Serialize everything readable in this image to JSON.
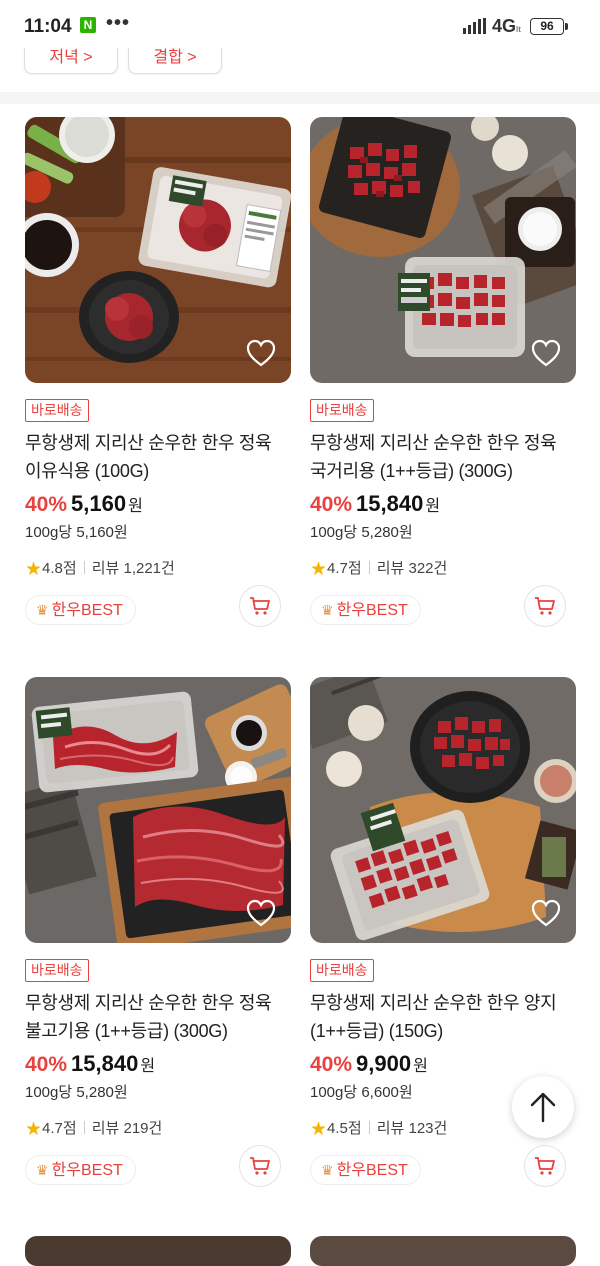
{
  "status_bar": {
    "time": "11:04",
    "notif_badge": "N",
    "dots": "•••",
    "network": "4G",
    "network_sub": "lt",
    "battery": "96"
  },
  "top_chips": [
    "저녁 >",
    "결합 >"
  ],
  "products": [
    {
      "badge": "바로배송",
      "title": "무항생제 지리산 순우한 한우 정육 이유식용 (100G)",
      "discount": "40%",
      "price": "5,160",
      "currency": "원",
      "unit_price": "100g당 5,160원",
      "rating": "4.8점",
      "reviews": "리뷰 1,221건",
      "tag": "한우BEST"
    },
    {
      "badge": "바로배송",
      "title": "무항생제 지리산 순우한 한우 정육 국거리용 (1++등급) (300G)",
      "discount": "40%",
      "price": "15,840",
      "currency": "원",
      "unit_price": "100g당 5,280원",
      "rating": "4.7점",
      "reviews": "리뷰 322건",
      "tag": "한우BEST"
    },
    {
      "badge": "바로배송",
      "title": "무항생제 지리산 순우한 한우 정육 불고기용 (1++등급) (300G)",
      "discount": "40%",
      "price": "15,840",
      "currency": "원",
      "unit_price": "100g당 5,280원",
      "rating": "4.7점",
      "reviews": "리뷰 219건",
      "tag": "한우BEST"
    },
    {
      "badge": "바로배송",
      "title": "무항생제 지리산 순우한 한우 양지 (1++등급) (150G)",
      "discount": "40%",
      "price": "9,900",
      "currency": "원",
      "unit_price": "100g당 6,600원",
      "rating": "4.5점",
      "reviews": "리뷰 123건",
      "tag": "한우BEST"
    }
  ],
  "package_label": "지리산 한우",
  "colors": {
    "accent": "#e8413e",
    "star": "#f4b400",
    "crown": "#e8913e"
  },
  "icons": {
    "heart": "heart-icon",
    "cart": "cart-icon",
    "top": "arrow-up-icon",
    "star": "star-icon",
    "crown": "crown-icon"
  }
}
